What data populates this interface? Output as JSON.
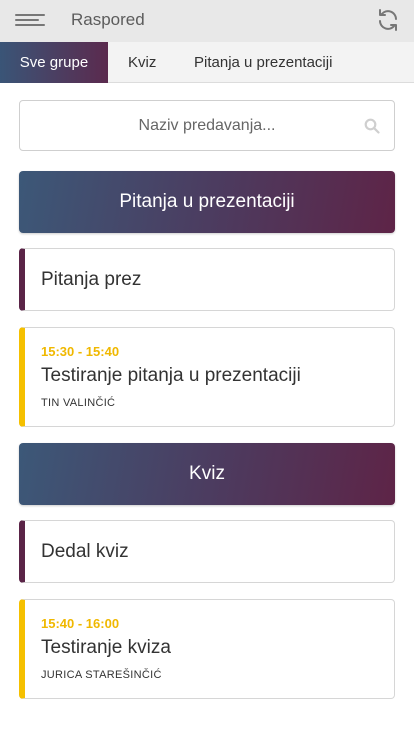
{
  "app": {
    "title": "Raspored"
  },
  "tabs": [
    {
      "label": "Sve grupe"
    },
    {
      "label": "Kviz"
    },
    {
      "label": "Pitanja u prezentaciji"
    }
  ],
  "search": {
    "placeholder": "Naziv predavanja..."
  },
  "sections": [
    {
      "header": "Pitanja u prezentaciji",
      "group": "Pitanja prez",
      "lecture": {
        "time": "15:30 - 15:40",
        "title": "Testiranje pitanja u prezentaciji",
        "speaker": "TIN VALINČIĆ"
      }
    },
    {
      "header": "Kviz",
      "group": "Dedal kviz",
      "lecture": {
        "time": "15:40 - 16:00",
        "title": "Testiranje kviza",
        "speaker": "JURICA STAREŠINČIĆ"
      }
    }
  ],
  "colors": {
    "accent_gold": "#f0b800",
    "header_gradient_start": "#3c5878",
    "header_gradient_end": "#5e2447"
  }
}
